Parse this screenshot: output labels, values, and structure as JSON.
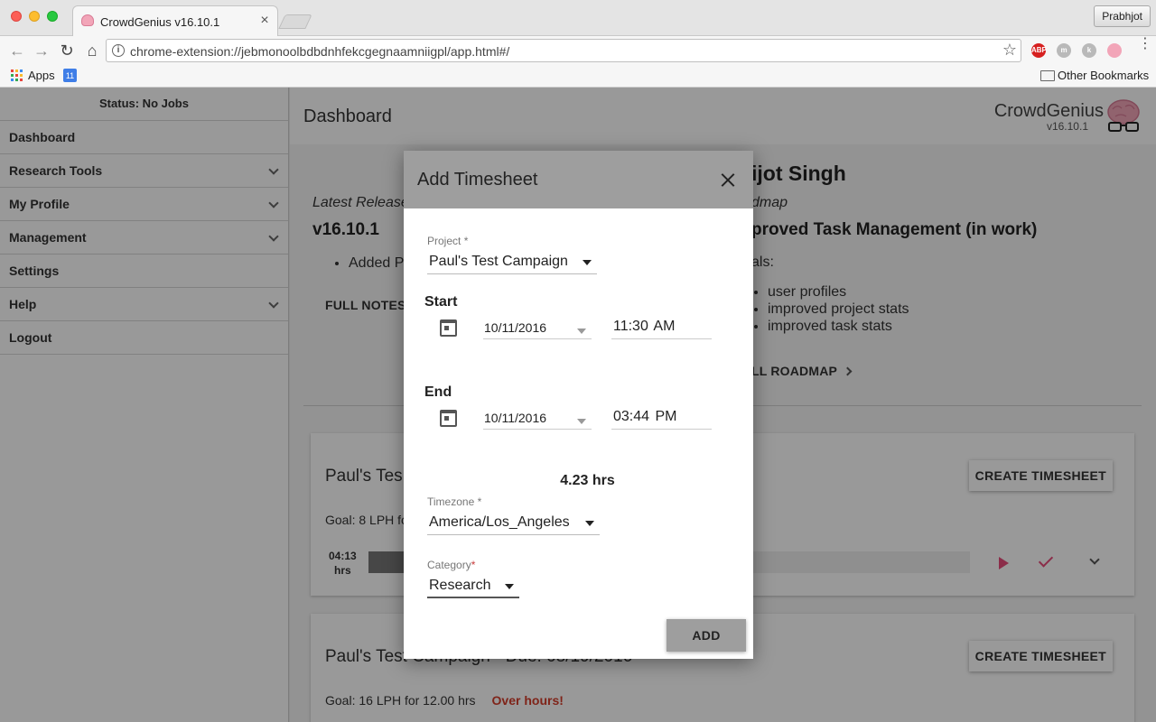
{
  "browser": {
    "tab_title": "CrowdGenius v16.10.1",
    "tab_close": "×",
    "profile_name": "Prabhjot",
    "url": "chrome-extension://jebmonoolbdbdnhfekcgegnaamniigpl/app.html#/",
    "info_glyph": "i",
    "star_glyph": "☆",
    "back_glyph": "←",
    "forward_glyph": "→",
    "reload_glyph": "↻",
    "home_glyph": "⌂",
    "menu_glyph": "⋮",
    "extensions": [
      {
        "name": "adblock-icon",
        "label": "ABP",
        "color": "#d6201f"
      },
      {
        "name": "m-extension-icon",
        "label": "m",
        "color": "#b9b9b9"
      },
      {
        "name": "k-extension-icon",
        "label": "k",
        "color": "#b9b9b9"
      },
      {
        "name": "crowdgenius-extension-icon",
        "label": "",
        "color": "#f2a5b8"
      }
    ],
    "bookmarks": {
      "apps_label": "Apps",
      "calendar_glyph": "11",
      "other_label": "Other Bookmarks"
    }
  },
  "sidebar": {
    "status": "Status: No Jobs",
    "items": [
      {
        "label": "Dashboard",
        "expandable": false
      },
      {
        "label": "Research Tools",
        "expandable": true
      },
      {
        "label": "My Profile",
        "expandable": true
      },
      {
        "label": "Management",
        "expandable": true
      },
      {
        "label": "Settings",
        "expandable": false
      },
      {
        "label": "Help",
        "expandable": true
      },
      {
        "label": "Logout",
        "expandable": false
      }
    ]
  },
  "header": {
    "title": "Dashboard",
    "brand": "CrowdGenius",
    "version": "v16.10.1"
  },
  "news": {
    "welcome": "ijot Singh",
    "latest_label": "Latest Release",
    "latest_version": "v16.10.1",
    "latest_bullets": [
      "Added P"
    ],
    "full_notes": "FULL NOTES",
    "roadmap_label": "dmap",
    "roadmap_title": "proved Task Management (in work)",
    "goals_label": "als:",
    "goals": [
      "user profiles",
      "improved project stats",
      "improved task stats"
    ],
    "full_roadmap": "LL ROADMAP"
  },
  "cards": [
    {
      "title": "Paul's Tes",
      "button": "CREATE TIMESHEET",
      "goal": "Goal: 8 LPH fo",
      "over": "",
      "hours_value": "04:13",
      "hours_unit": "hrs",
      "progress": 0.35
    },
    {
      "title": "Paul's Test Campaign - Due: 08/19/2016",
      "button": "CREATE TIMESHEET",
      "goal": "Goal: 16 LPH for 12.00 hrs",
      "over": "Over hours!"
    }
  ],
  "dialog": {
    "title": "Add Timesheet",
    "project_label": "Project",
    "project_value": "Paul's Test Campaign",
    "required_mark": "*",
    "start_label": "Start",
    "start_date": "10/11/2016",
    "start_time": "11:30 AM",
    "end_label": "End",
    "end_date": "10/11/2016",
    "end_time": "03:44 PM",
    "duration": "4.23 hrs",
    "timezone_label": "Timezone",
    "timezone_value": "America/Los_Angeles",
    "category_label": "Category",
    "category_value": "Research",
    "add_button": "ADD"
  },
  "colors": {
    "accent": "#e84c7a",
    "warning": "#d43c2a"
  }
}
